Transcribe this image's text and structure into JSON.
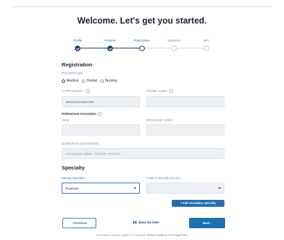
{
  "header": {
    "title": "Welcome. Let's get you started."
  },
  "steps": [
    {
      "label": "Profile",
      "state": "done"
    },
    {
      "label": "Practice",
      "state": "done"
    },
    {
      "label": "Registration",
      "state": "current"
    },
    {
      "label": "Signature",
      "state": "todo"
    },
    {
      "label": "MFA",
      "state": "todo"
    }
  ],
  "registration": {
    "heading": "Registration",
    "practitioner_type_label": "Practitioner type",
    "practitioner_options": [
      "Medical",
      "Dental",
      "Nursing"
    ],
    "selected_practitioner": "Medical",
    "ahpra_label": "AHPRA Number *",
    "ahpra_value": "MED0001234567890",
    "provider_label": "Provider number",
    "provider_value": "",
    "professional_association_label": "Professional Association",
    "name_label": "Name",
    "name_value": "",
    "membership_label": "Membership number",
    "membership_value": "",
    "qualifications_label": "Qualifications (postnominals)",
    "qualifications_placeholder": "For example: MBBS, FRACGP, FRACOG"
  },
  "specialty": {
    "heading": "Specialty",
    "primary_label": "Primary Specialty *",
    "primary_value": "Physician",
    "fields_label": "Fields of specialty practice",
    "fields_value": "",
    "add_secondary_label": "+  Add secondary specialty"
  },
  "actions": {
    "previous_label": "‹  Previous",
    "save_label": "Save for later",
    "next_label": "Next  ›"
  },
  "footer": {
    "prefix": "By creating an account, I agree to Consultmed's ",
    "terms_link": "Terms & Conditions",
    "middle": " and ",
    "privacy_link": "Privacy Policy",
    "suffix": "."
  },
  "colors": {
    "primary": "#1f6fb2",
    "dark": "#17416b",
    "field_bg": "#eef1f4"
  }
}
